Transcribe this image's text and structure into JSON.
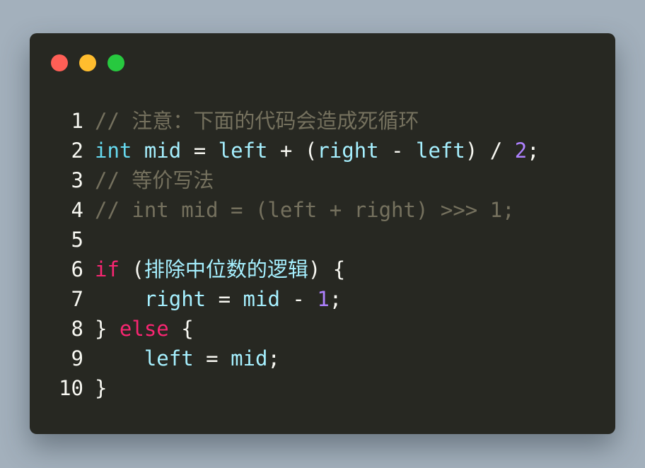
{
  "window": {
    "controls": [
      "close",
      "minimize",
      "maximize"
    ],
    "colors": {
      "background": "#272822",
      "close": "#ff5f56",
      "minimize": "#ffbd2e",
      "maximize": "#27c93f",
      "page_background": "#a3b0bc"
    }
  },
  "code": {
    "lines": [
      {
        "n": "1",
        "comment": "// 注意：下面的代码会造成死循环"
      },
      {
        "n": "2",
        "t1": "int",
        "t2": " mid",
        "t3": " = ",
        "t4": "left",
        "t5": " + (",
        "t6": "right",
        "t7": " - ",
        "t8": "left",
        "t9": ") / ",
        "t10": "2",
        "t11": ";"
      },
      {
        "n": "3",
        "comment": "// 等价写法"
      },
      {
        "n": "4",
        "comment": "// int mid = (left + right) >>> 1;"
      },
      {
        "n": "5"
      },
      {
        "n": "6",
        "t1": "if",
        "t2": " (",
        "t3": "排除中位数的逻辑",
        "t4": ") {"
      },
      {
        "n": "7",
        "t1": "    ",
        "t2": "right",
        "t3": " = ",
        "t4": "mid",
        "t5": " - ",
        "t6": "1",
        "t7": ";"
      },
      {
        "n": "8",
        "t1": "} ",
        "t2": "else",
        "t3": " {"
      },
      {
        "n": "9",
        "t1": "    ",
        "t2": "left",
        "t3": " = ",
        "t4": "mid",
        "t5": ";"
      },
      {
        "n": "10",
        "t1": "}"
      }
    ]
  }
}
